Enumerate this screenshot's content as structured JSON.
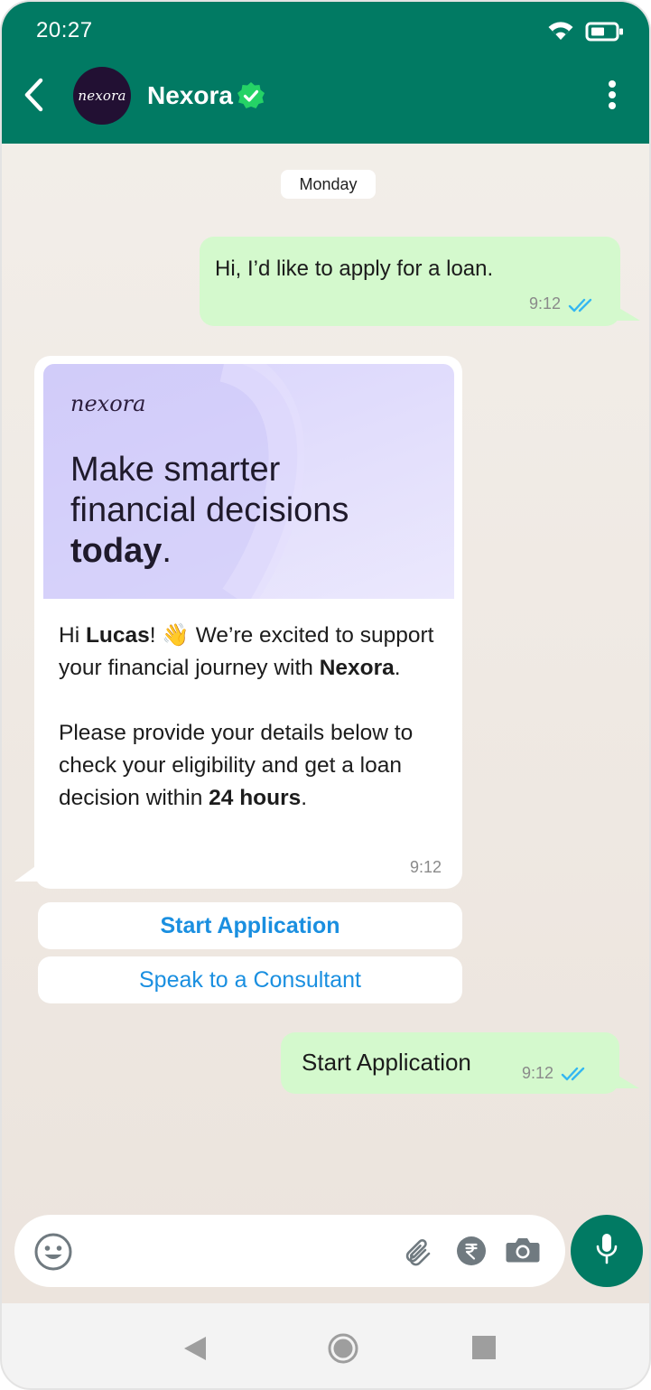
{
  "status_bar": {
    "time": "20:27"
  },
  "header": {
    "contact_name": "Nexora",
    "avatar_text": "nexora"
  },
  "chat": {
    "date_label": "Monday",
    "messages": [
      {
        "text": "Hi, I’d like to apply for a loan.",
        "time": "9:12"
      },
      {
        "banner": {
          "logo": "nexora",
          "headline_line1": "Make smarter",
          "headline_line2": "financial decisions",
          "headline_bold": "today",
          "headline_end": "."
        },
        "body": {
          "greeting_prefix": "Hi ",
          "name": "Lucas",
          "greeting_suffix": "! 👋 We’re excited to support your financial journey with ",
          "brand": "Nexora",
          "brand_suffix": ".",
          "para2_prefix": "Please provide your details below to check your eligibility and get a loan decision within ",
          "para2_bold": "24 hours",
          "para2_suffix": "."
        },
        "time": "9:12"
      },
      {
        "text": "Start Application",
        "time": "9:12"
      }
    ],
    "quick_replies": [
      "Start Application",
      "Speak to a Consultant"
    ]
  },
  "colors": {
    "header": "#017a63",
    "outgoing_bubble": "#d4f9cd",
    "link_blue": "#1a8fe0",
    "read_ticks": "#34b7f1"
  },
  "icons": [
    "back-arrow-icon",
    "verified-badge-icon",
    "more-vert-icon",
    "wifi-icon",
    "battery-icon",
    "emoji-icon",
    "attach-icon",
    "rupee-icon",
    "camera-icon",
    "mic-icon"
  ]
}
